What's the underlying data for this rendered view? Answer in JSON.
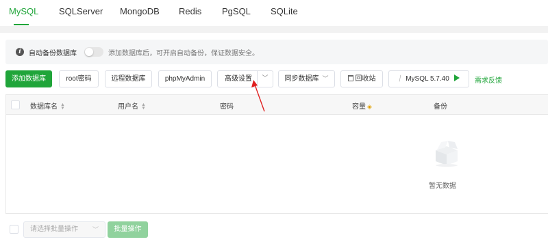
{
  "tabs": [
    {
      "label": "MySQL",
      "active": true
    },
    {
      "label": "SQLServer",
      "active": false
    },
    {
      "label": "MongoDB",
      "active": false
    },
    {
      "label": "Redis",
      "active": false
    },
    {
      "label": "PgSQL",
      "active": false
    },
    {
      "label": "SQLite",
      "active": false
    }
  ],
  "notice": {
    "title": "自动备份数据库",
    "toggle_on": false,
    "hint": "添加数据库后，可开启自动备份，保证数据安全。"
  },
  "toolbar": {
    "add_database": "添加数据库",
    "root_password": "root密码",
    "remote_database": "远程数据库",
    "phpmyadmin": "phpMyAdmin",
    "advanced_settings": "高级设置",
    "sync_database": "同步数据库",
    "recycle_bin": "回收站",
    "mysql_version": "MySQL 5.7.40",
    "feedback": "需求反馈"
  },
  "table": {
    "columns": [
      "数据库名",
      "用户名",
      "密码",
      "容量",
      "备份"
    ],
    "rows": [],
    "empty_text": "暂无数据"
  },
  "footer": {
    "batch_placeholder": "请选择批量操作",
    "batch_button": "批量操作"
  },
  "colors": {
    "accent": "#20a53a",
    "annotation_arrow": "#e02020"
  },
  "icons": [
    "info-icon",
    "chevron-down-icon",
    "trash-icon",
    "mysql-leaf-icon",
    "play-icon",
    "sort-icon",
    "eye-icon",
    "empty-box-icon"
  ]
}
